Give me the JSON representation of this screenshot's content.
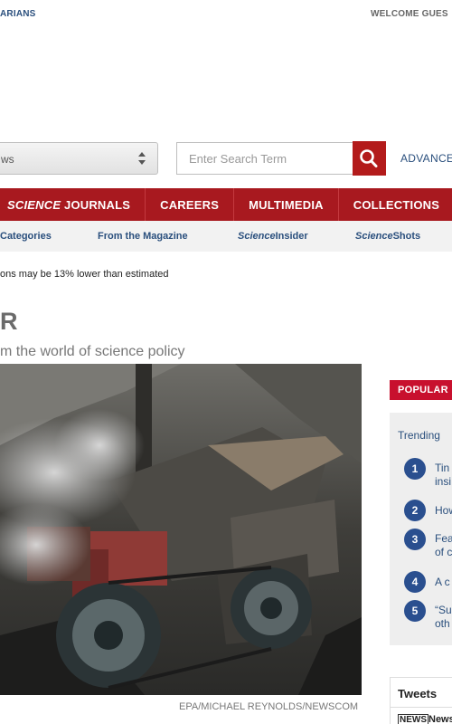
{
  "top_bar": {
    "left_link": "ARIANS",
    "right_text": "WELCOME GUES"
  },
  "search": {
    "category_value": "ws",
    "placeholder": "Enter Search Term",
    "advanced_label": "ADVANCE"
  },
  "nav": {
    "items": [
      {
        "label_italic": "SCIENCE",
        "label": " JOURNALS"
      },
      {
        "label": "CAREERS"
      },
      {
        "label": "MULTIMEDIA"
      },
      {
        "label": "COLLECTIONS"
      }
    ]
  },
  "subnav": {
    "items": [
      {
        "label": "Categories"
      },
      {
        "label": "From the Magazine"
      },
      {
        "label_italic": "Science",
        "label": "Insider"
      },
      {
        "label_italic": "Science",
        "label": "Shots"
      }
    ]
  },
  "breaking": "ons may be 13% lower than estimated",
  "article": {
    "heading": "R",
    "subheading": "m the world of science policy",
    "image_credit": "EPA/MICHAEL REYNOLDS/NEWSCOM",
    "caption": "......................"
  },
  "sidebar": {
    "popular_label": "POPULAR",
    "trending_label": "Trending",
    "trending_items": [
      {
        "num": "1",
        "line1": "Tin",
        "line2": "insi"
      },
      {
        "num": "2",
        "line1": "How",
        "line2": ""
      },
      {
        "num": "3",
        "line1": "Fea",
        "line2": "of c"
      },
      {
        "num": "4",
        "line1": "A c",
        "line2": ""
      },
      {
        "num": "5",
        "line1": "“Su",
        "line2": "oth"
      }
    ],
    "tweets_label": "Tweets",
    "news_badge": "NEWS",
    "news_text": "News"
  },
  "colors": {
    "nav_red": "#a8191f",
    "popular_red": "#c8102e",
    "link_blue": "#2a4f7d",
    "trend_circle": "#2a4f8f"
  },
  "icons": [
    "sort-arrows-icon",
    "search-icon"
  ]
}
